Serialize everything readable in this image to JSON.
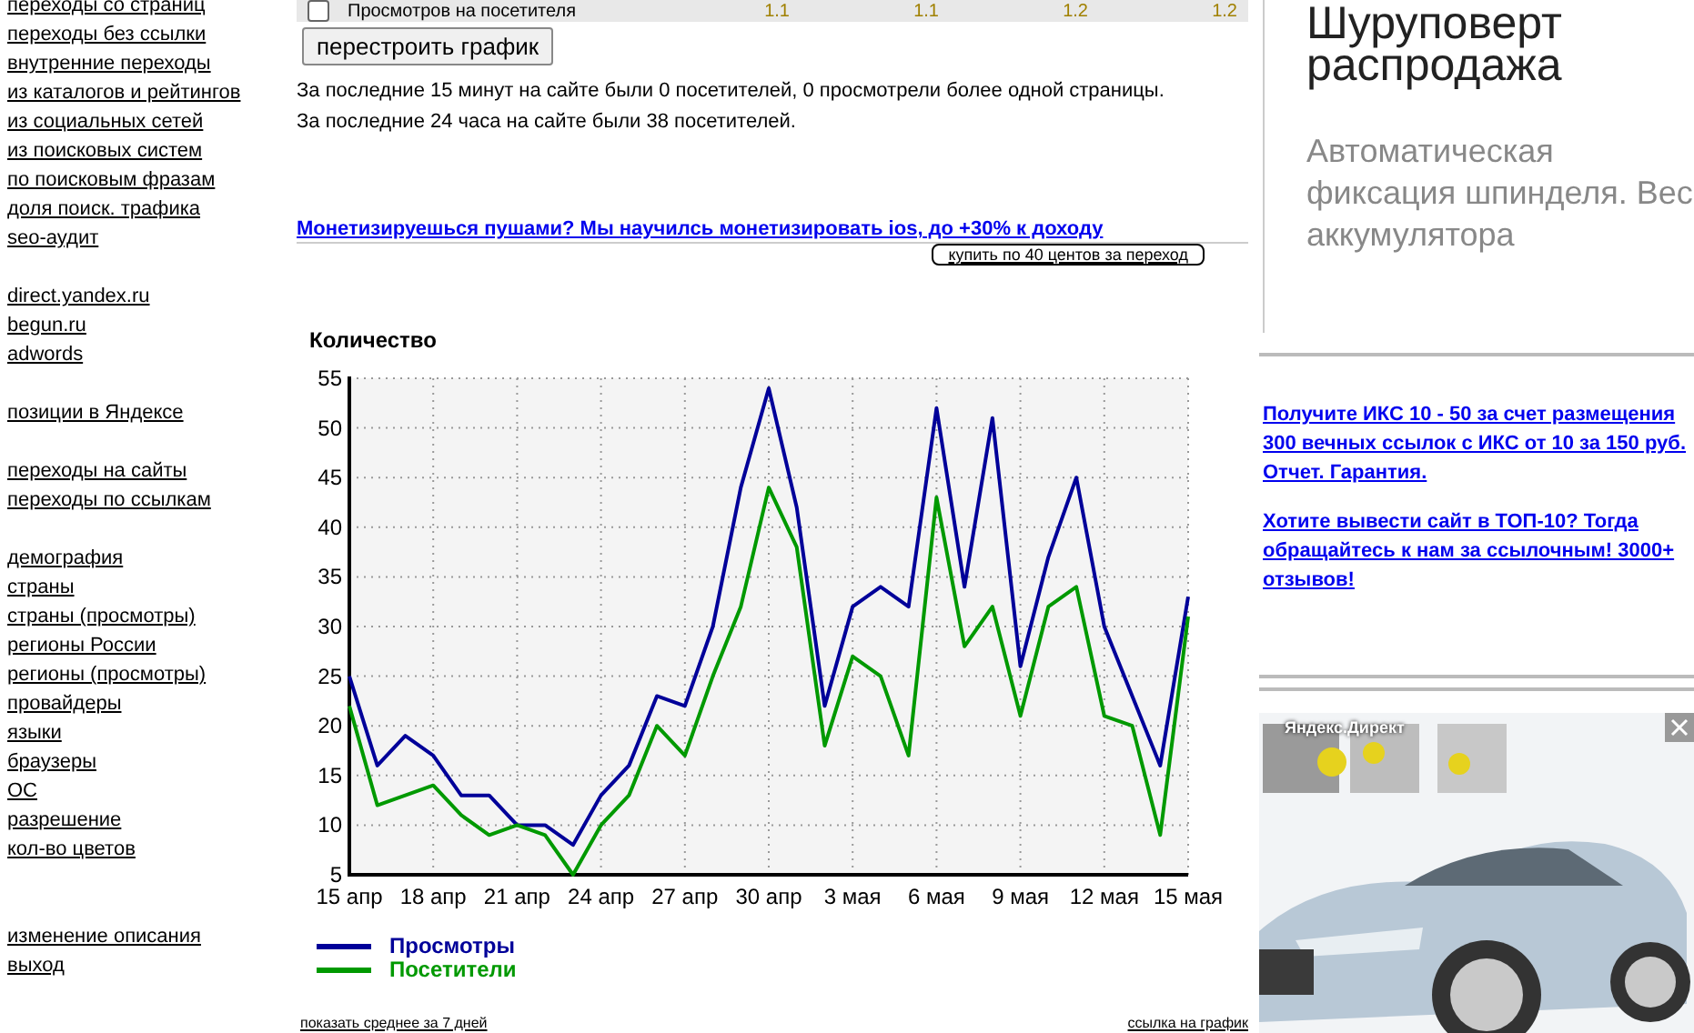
{
  "sidebar": {
    "groups": [
      [
        "переходы со страниц",
        "переходы без ссылки",
        "внутренние переходы",
        "из каталогов и рейтингов",
        "из социальных сетей",
        "из поисковых систем",
        "по поисковым фразам",
        "доля поиск. трафика",
        "seo-аудит"
      ],
      [
        "direct.yandex.ru",
        "begun.ru",
        "adwords"
      ],
      [
        "позиции в Яндексе"
      ],
      [
        "переходы на сайты",
        "переходы по ссылкам"
      ],
      [
        "демография",
        "страны",
        "страны (просмотры)",
        "регионы России",
        "регионы (просмотры)",
        "провайдеры",
        "языки",
        "браузеры",
        "ОС",
        "разрешение",
        "кол-во цветов"
      ],
      [
        "изменение описания",
        "выход"
      ]
    ]
  },
  "summary_row": {
    "label": "Просмотров на посетителя",
    "checked": false,
    "values": [
      "1.1",
      "1.1",
      "1.2",
      "1.2"
    ]
  },
  "rebuild_button": "перестроить график",
  "stats": [
    "За последние 15 минут на сайте были 0 посетителей, 0 просмотрели более одной страницы.",
    "За последние 24 часа на сайте были 38 посетителей."
  ],
  "promo_link": "Монетизируешься пушами? Мы научилсь монетизировать ios, до +30% к доходу",
  "buy_button": "купить по 40 центов за переход",
  "chart_data": {
    "type": "line",
    "title": "Количество",
    "categories": [
      "15 апр",
      null,
      null,
      "18 апр",
      null,
      null,
      "21 апр",
      null,
      null,
      "24 апр",
      null,
      null,
      "27 апр",
      null,
      null,
      "30 апр",
      null,
      null,
      "3 мая",
      null,
      null,
      "6 мая",
      null,
      null,
      "9 мая",
      null,
      null,
      "12 мая",
      null,
      null,
      "15 мая"
    ],
    "grid": true,
    "ylim": [
      5,
      55
    ],
    "yticks": [
      5,
      10,
      15,
      20,
      25,
      30,
      35,
      40,
      45,
      50,
      55
    ],
    "series": [
      {
        "name": "Просмотры",
        "color": "#000099",
        "values": [
          25,
          16,
          19,
          17,
          13,
          13,
          10,
          10,
          8,
          13,
          16,
          23,
          22,
          30,
          44,
          54,
          42,
          22,
          32,
          34,
          32,
          52,
          34,
          51,
          26,
          37,
          45,
          30,
          23,
          16,
          33
        ]
      },
      {
        "name": "Посетители",
        "color": "#009900",
        "values": [
          22,
          12,
          13,
          14,
          11,
          9,
          10,
          9,
          5,
          10,
          13,
          20,
          17,
          25,
          32,
          44,
          38,
          18,
          27,
          25,
          17,
          43,
          28,
          32,
          21,
          32,
          34,
          21,
          20,
          9,
          31
        ]
      }
    ]
  },
  "chart_footer": {
    "left": "показать среднее за 7 дней",
    "right": "ссылка на график"
  },
  "right_ad": {
    "title": "Шуруповерт распродажа",
    "body": "Автоматическая фиксация шпинделя. Вес аккумулятора"
  },
  "right_links": [
    "Получите ИКС 10 - 50 за счет размещения 300 вечных ссылок с ИКС от 10 за 150 руб. Отчет. Гарантия.",
    "Хотите вывести сайт в ТОП-10? Тогда обращайтесь к нам за ссылочным! 3000+ отзывов!"
  ],
  "yandex_ad": {
    "label": "Яндекс.Директ"
  }
}
